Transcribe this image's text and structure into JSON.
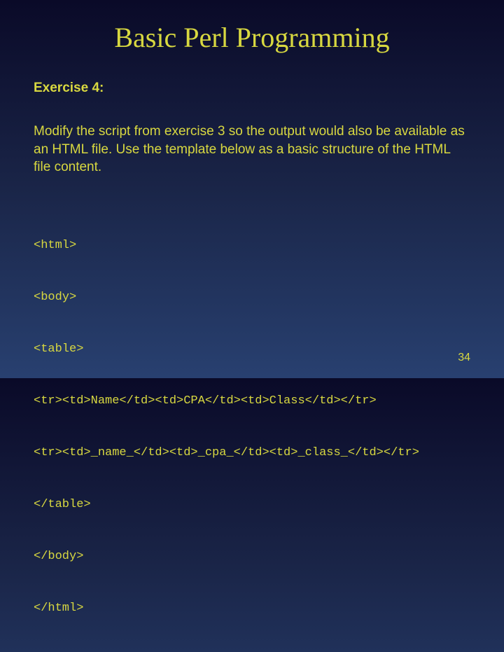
{
  "slide": {
    "title": "Basic Perl Programming",
    "exercise_label": "Exercise 4:",
    "description": "Modify the script from exercise 3 so the output would also be available as an HTML file. Use the template below as a basic structure of the HTML file content.",
    "code_lines": [
      "<html>",
      "<body>",
      "<table>",
      "<tr><td>Name</td><td>CPA</td><td>Class</td></tr>",
      "<tr><td>_name_</td><td>_cpa_</td><td>_class_</td></tr>",
      "</table>",
      "</body>",
      "</html>"
    ],
    "page_number": "34"
  }
}
